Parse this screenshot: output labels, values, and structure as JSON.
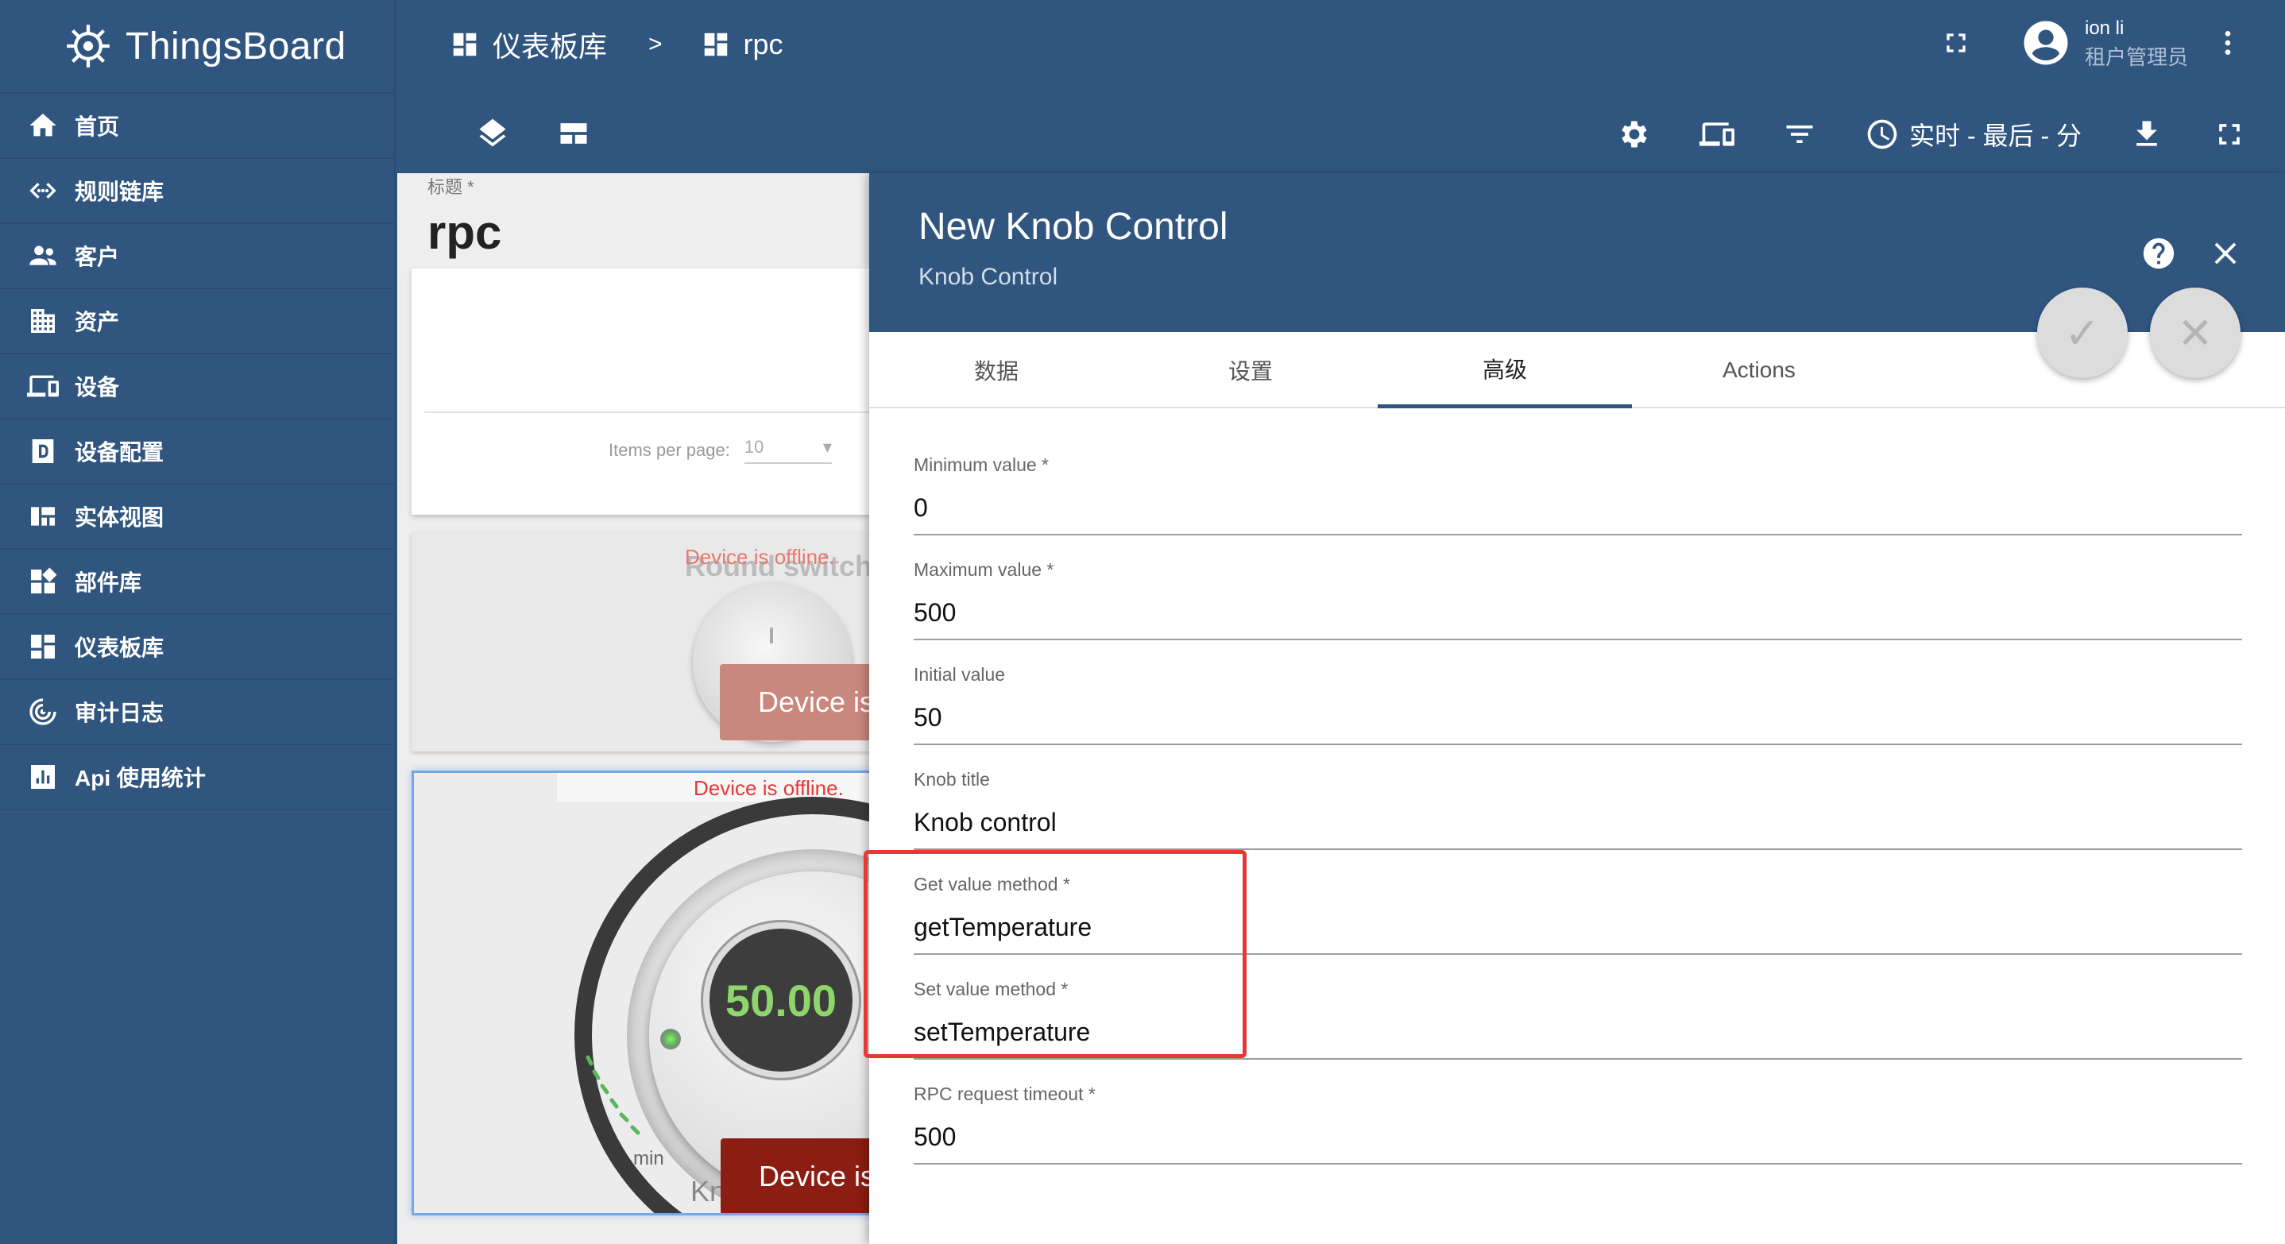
{
  "app": {
    "brand": "ThingsBoard"
  },
  "sidebar": {
    "items": [
      {
        "label": "首页",
        "icon": "home-icon"
      },
      {
        "label": "规则链库",
        "icon": "code-arrows-icon"
      },
      {
        "label": "客户",
        "icon": "people-icon"
      },
      {
        "label": "资产",
        "icon": "building-icon"
      },
      {
        "label": "设备",
        "icon": "devices-icon"
      },
      {
        "label": "设备配置",
        "icon": "device-profile-icon"
      },
      {
        "label": "实体视图",
        "icon": "view-quilt-icon"
      },
      {
        "label": "部件库",
        "icon": "widgets-icon"
      },
      {
        "label": "仪表板库",
        "icon": "dashboard-icon"
      },
      {
        "label": "审计日志",
        "icon": "track-changes-icon"
      },
      {
        "label": "Api 使用统计",
        "icon": "insert-chart-icon"
      }
    ]
  },
  "header": {
    "breadcrumb": [
      {
        "label": "仪表板库",
        "icon": "dashboard-icon"
      },
      {
        "label": "rpc",
        "icon": "dashboard-icon"
      }
    ],
    "breadcrumb_separator": ">",
    "user": {
      "name": "ion li",
      "role": "租户管理员"
    }
  },
  "toolbar": {
    "timewindow_label": "实时 - 最后 - 分"
  },
  "dashboard": {
    "title_label": "标题 *",
    "title_value": "rpc",
    "items_per_page_label": "Items per page:",
    "items_per_page_value": "10",
    "round_switch_title": "Round switch",
    "offline_message": "Device is offline.",
    "device_button_text": "Device is",
    "knob_value": "50.00",
    "knob_min_label": "min",
    "knob_title_partial": "Kn"
  },
  "panel": {
    "title": "New Knob Control",
    "subtitle": "Knob Control",
    "tabs": [
      "数据",
      "设置",
      "高级",
      "Actions"
    ],
    "active_tab": "高级",
    "fields": [
      {
        "label": "Minimum value *",
        "value": "0"
      },
      {
        "label": "Maximum value *",
        "value": "500"
      },
      {
        "label": "Initial value",
        "value": "50"
      },
      {
        "label": "Knob title",
        "value": "Knob control"
      },
      {
        "label": "Get value method *",
        "value": "getTemperature"
      },
      {
        "label": "Set value method *",
        "value": "setTemperature"
      },
      {
        "label": "RPC request timeout *",
        "value": "500"
      }
    ]
  },
  "colors": {
    "primary": "#305680",
    "offline_text": "#e53935",
    "highlight": "#e53935",
    "knob_display_text": "#8fd66a"
  }
}
